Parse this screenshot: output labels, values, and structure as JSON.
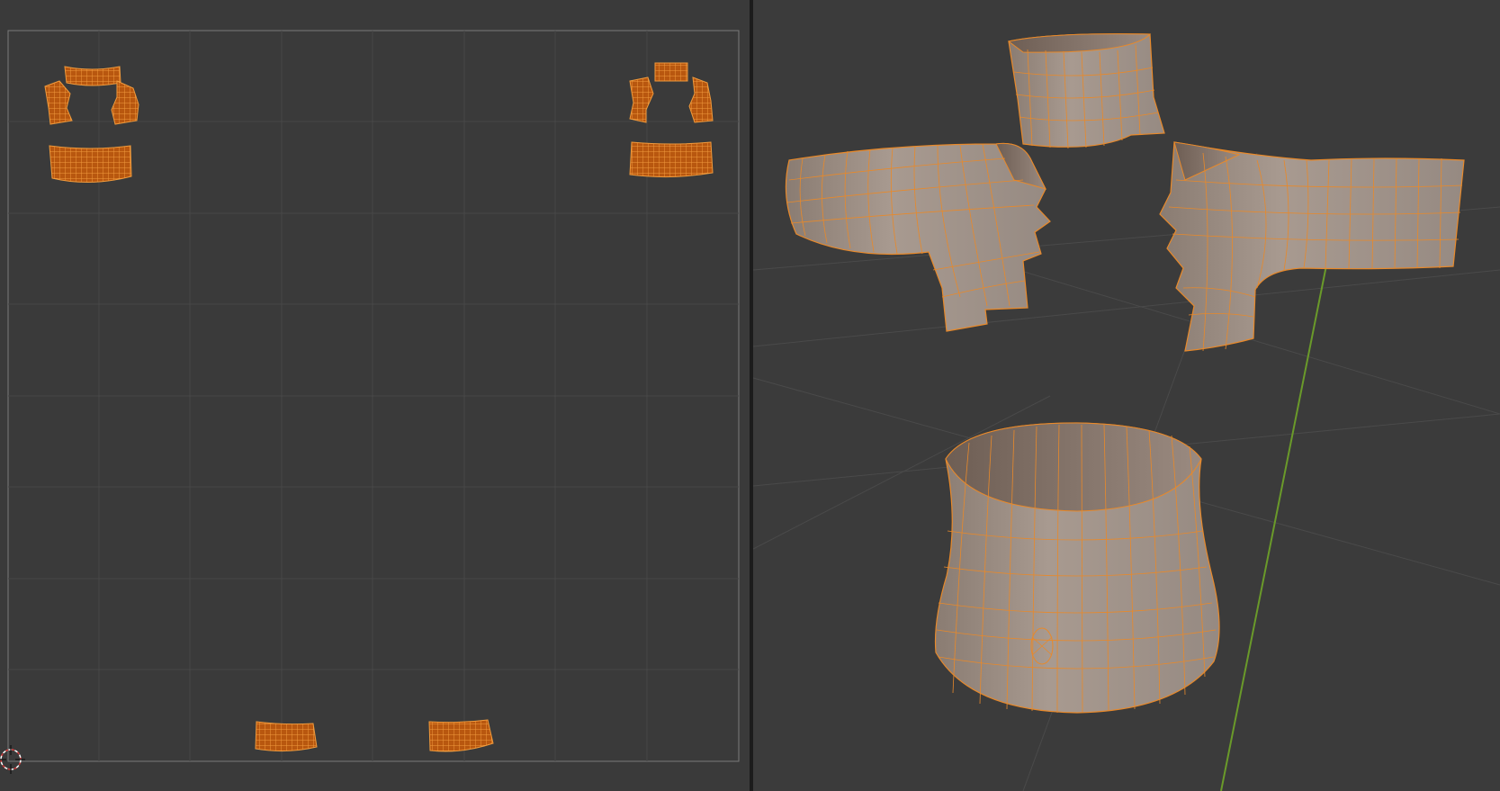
{
  "window": {
    "editors": [
      "uv-editor",
      "3d-viewport"
    ]
  },
  "uv_editor": {
    "grid_lines": 8,
    "islands": [
      "uv-island-left-sleeve-top",
      "uv-island-left-sleeve-side-a",
      "uv-island-left-sleeve-side-b",
      "uv-island-left-sleeve-band",
      "uv-island-right-sleeve-top",
      "uv-island-right-sleeve-side-a",
      "uv-island-right-sleeve-side-b",
      "uv-island-right-sleeve-band",
      "uv-island-collar-left",
      "uv-island-collar-right"
    ]
  },
  "viewport": {
    "objects": [
      "collar-mesh",
      "left-sleeve-mesh",
      "right-sleeve-mesh",
      "waist-band-mesh"
    ]
  },
  "colors": {
    "uv_background": "#3a3a3a",
    "viewport_background": "#3b3b3b",
    "grid": "#4a4a4a",
    "uv_border": "#7a7a7a",
    "selection_orange": "#e8892a",
    "uv_fill": "#b8570f",
    "mesh_fill": "#a09288",
    "mesh_shade": "#7e6f66",
    "axis_green": "#6a9a2a"
  }
}
